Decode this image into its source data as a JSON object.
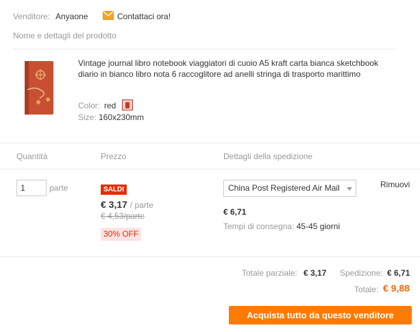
{
  "seller": {
    "label": "Venditore:",
    "name": "Anyaone",
    "contact_label": "Contattaci ora!"
  },
  "product_section": {
    "heading": "Nome e dettagli del prodotto"
  },
  "product": {
    "title": "Vintage journal libro notebook viaggiatori di cuoio A5 kraft carta bianca sketchbook diario in bianco libro nota 6 raccoglitore ad anelli stringa di trasporto marittimo",
    "color_label": "Color:",
    "color_value": "red",
    "size_label": "Size:",
    "size_value": "160x230mm"
  },
  "columns": {
    "quantity": "Quantità",
    "price": "Prezzo",
    "shipping": "Dettagli della spedizione"
  },
  "line_item": {
    "quantity": "1",
    "unit": "parte",
    "sale_badge": "SALDI",
    "price": "€ 3,17",
    "price_unit": "/ parte",
    "old_price": "€ 4,53/parte",
    "discount": "30% OFF",
    "shipping_method": "China Post Registered Air Mail",
    "shipping_price": "€ 6,71",
    "delivery_label": "Tempi di consegna:",
    "delivery_value": "45-45 giorni",
    "remove_label": "Rimuovi"
  },
  "summary": {
    "subtotal_label": "Totale parziale:",
    "subtotal_value": "€ 3,17",
    "shipping_label": "Spedizione:",
    "shipping_value": "€ 6,71",
    "total_label": "Totale:",
    "total_value": "€ 9,88",
    "buy_button": "Acquista tutto da questo venditore"
  },
  "colors": {
    "accent_orange": "#ff7a00",
    "sale_red": "#e62e04",
    "total_orange": "#ff6600"
  }
}
